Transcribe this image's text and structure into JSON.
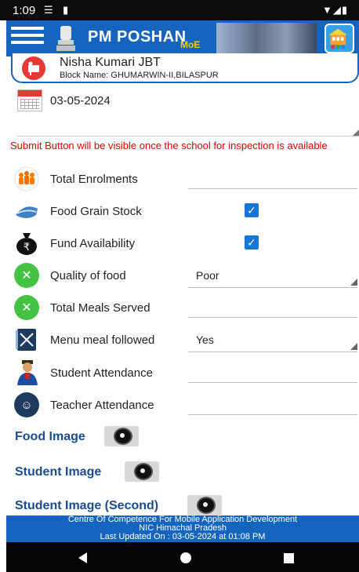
{
  "status_bar": {
    "time": "1:09",
    "icons": [
      "nfc-icon",
      "sd-card-icon",
      "wifi-icon",
      "signal-icon",
      "battery-icon"
    ]
  },
  "app_bar": {
    "title": "PM POSHAN",
    "subtitle": "MoE"
  },
  "user": {
    "name": "Nisha Kumari JBT",
    "block": "Block Name: GHUMARWIN-II,BILASPUR"
  },
  "date": "03-05-2024",
  "warning": "Submit Button will be visible once the school for inspection is available",
  "fields": {
    "total_enrolments": {
      "label": "Total Enrolments",
      "value": ""
    },
    "food_grain_stock": {
      "label": "Food Grain Stock",
      "checked": true
    },
    "fund_availability": {
      "label": "Fund Availability",
      "checked": true
    },
    "quality_of_food": {
      "label": "Quality of food",
      "value": "Poor"
    },
    "total_meals_served": {
      "label": "Total Meals Served",
      "value": ""
    },
    "menu_meal_followed": {
      "label": "Menu meal followed",
      "value": "Yes"
    },
    "student_attendance": {
      "label": "Student Attendance",
      "value": ""
    },
    "teacher_attendance": {
      "label": "Teacher Attendance",
      "value": ""
    }
  },
  "images": {
    "food": "Food Image",
    "student": "Student Image",
    "student_second": "Student Image (Second)"
  },
  "footer": {
    "line1": "Centre Of Competence For Mobile Application Development",
    "line2": "NIC Himachal Pradesh",
    "line3": "Last Updated On : 03-05-2024 at 01:08 PM"
  },
  "colors": {
    "primary": "#1565c0",
    "warning": "#e00000",
    "image_label": "#1a4c8f",
    "checkbox": "#1976d2"
  }
}
